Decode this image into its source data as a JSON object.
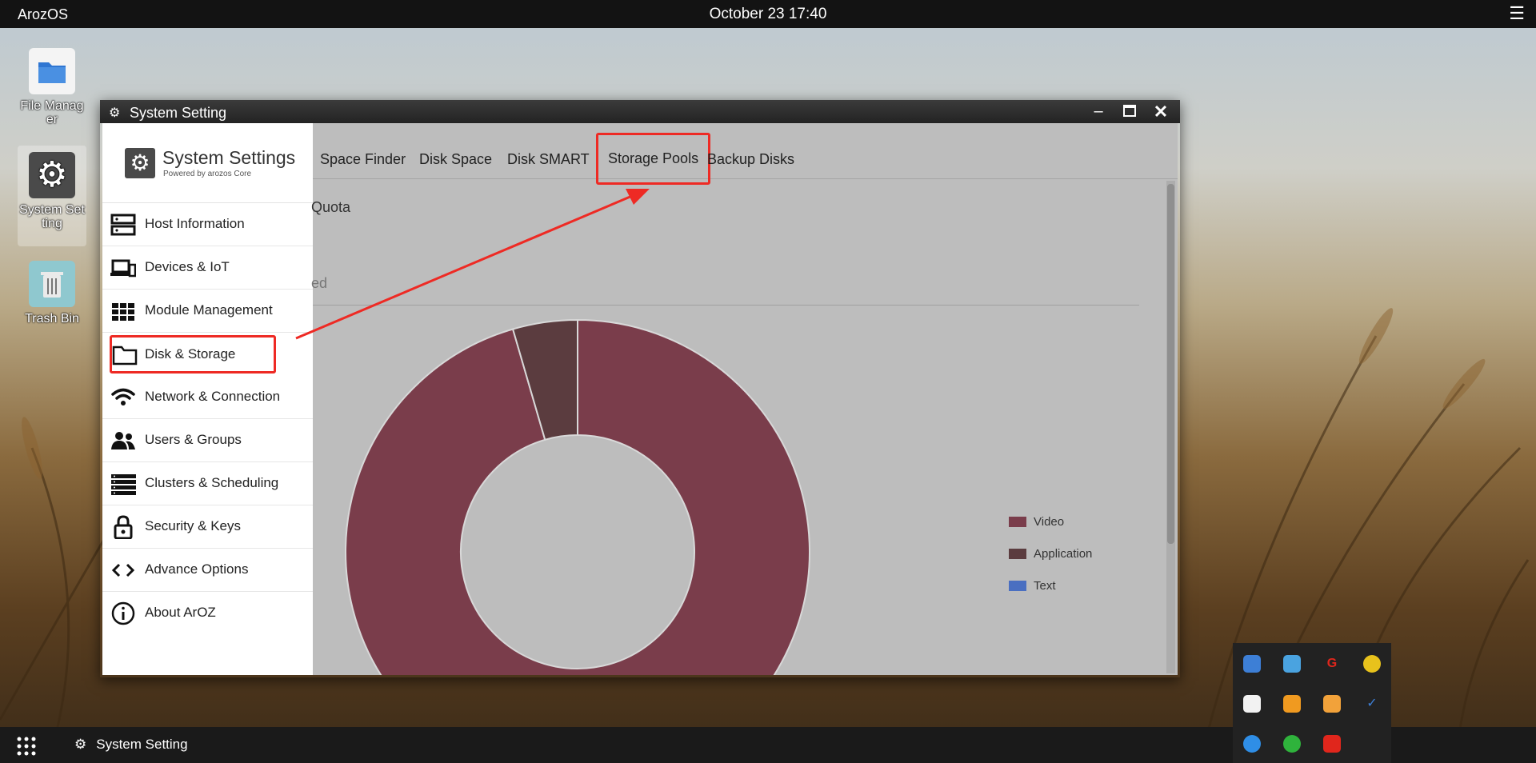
{
  "topbar": {
    "brand": "ArozOS",
    "clock": "October 23 17:40",
    "menu_icon": "hamburger-icon"
  },
  "desktop": [
    {
      "label": "File Manag\ner",
      "icon": "folder-icon"
    },
    {
      "label": "System Set\nting",
      "icon": "gear-icon"
    },
    {
      "label": "Trash Bin",
      "icon": "trash-icon"
    }
  ],
  "window": {
    "title": "System Setting",
    "sidebar": {
      "title": "System Settings",
      "subtitle": "Powered by arozos Core",
      "items": [
        {
          "label": "Host Information",
          "icon": "server-icon"
        },
        {
          "label": "Devices & IoT",
          "icon": "devices-icon"
        },
        {
          "label": "Module Management",
          "icon": "grid-icon"
        },
        {
          "label": "Disk & Storage",
          "icon": "folder-outline-icon"
        },
        {
          "label": "Network & Connection",
          "icon": "wifi-icon"
        },
        {
          "label": "Users & Groups",
          "icon": "users-icon"
        },
        {
          "label": "Clusters & Scheduling",
          "icon": "list-icon"
        },
        {
          "label": "Security & Keys",
          "icon": "lock-icon"
        },
        {
          "label": "Advance Options",
          "icon": "code-icon"
        },
        {
          "label": "About ArOZ",
          "icon": "info-icon"
        }
      ]
    },
    "tabs": [
      "Space Finder",
      "Disk Space",
      "Disk SMART",
      "Storage Pools",
      "Backup Disks"
    ],
    "content": {
      "fragment_1": "Quota",
      "fragment_2": "ed"
    }
  },
  "chart_data": {
    "type": "pie",
    "labels": [
      "Video",
      "Application",
      "Text"
    ],
    "values": [
      95.5,
      4.5,
      0
    ],
    "colors": [
      "#7a3d4b",
      "#5b3c3f",
      "#4a6fc1"
    ]
  },
  "taskbar": {
    "task_label": "System Setting"
  }
}
